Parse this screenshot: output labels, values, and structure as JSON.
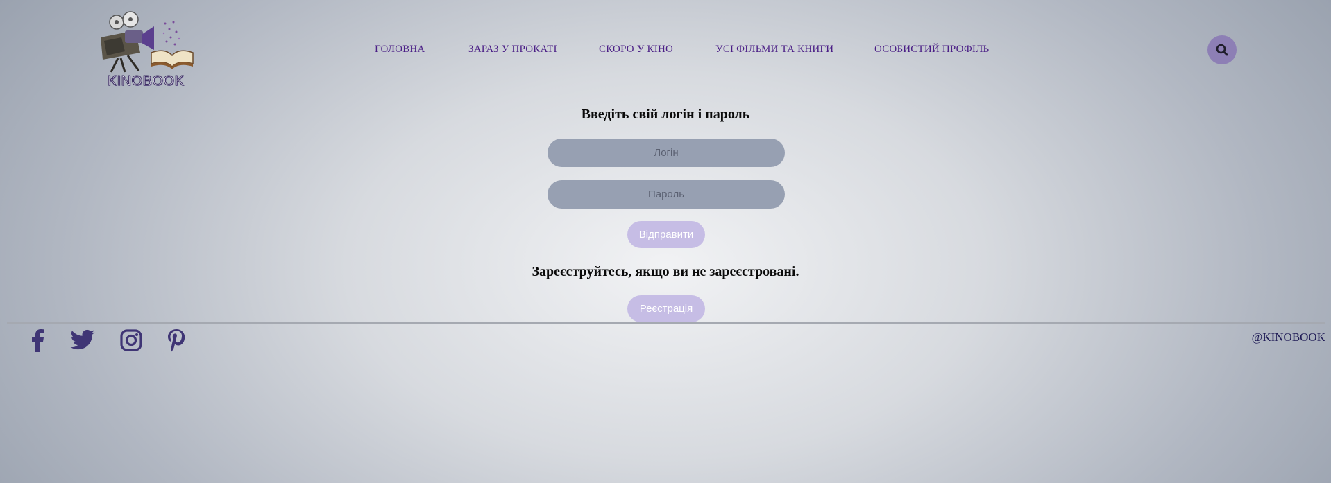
{
  "brand": {
    "name": "KINOBOOK"
  },
  "nav": {
    "items": [
      {
        "label": "ГОЛОВНА"
      },
      {
        "label": "ЗАРАЗ У ПРОКАТІ"
      },
      {
        "label": "СКОРО У КІНО"
      },
      {
        "label": "УСІ ФІЛЬМИ ТА КНИГИ"
      },
      {
        "label": "ОСОБИСТИЙ ПРОФІЛЬ"
      }
    ],
    "search_icon": "search-icon"
  },
  "login": {
    "heading": "Введіть свій логін і пароль",
    "login_placeholder": "Логін",
    "password_placeholder": "Пароль",
    "submit_label": "Відправити"
  },
  "register": {
    "heading": "Зареєструйтесь, якщо ви не зареєстровані.",
    "button_label": "Реєстрація"
  },
  "footer": {
    "social_icons": [
      "facebook-icon",
      "twitter-icon",
      "instagram-icon",
      "pinterest-icon"
    ],
    "copyright": "@KINOBOOK"
  },
  "colors": {
    "accent": "#8d7fb5",
    "nav_text": "#4b1f86",
    "input_bg": "#97a0b2",
    "button_bg": "#c6bde5",
    "social_icon": "#3f3575"
  }
}
